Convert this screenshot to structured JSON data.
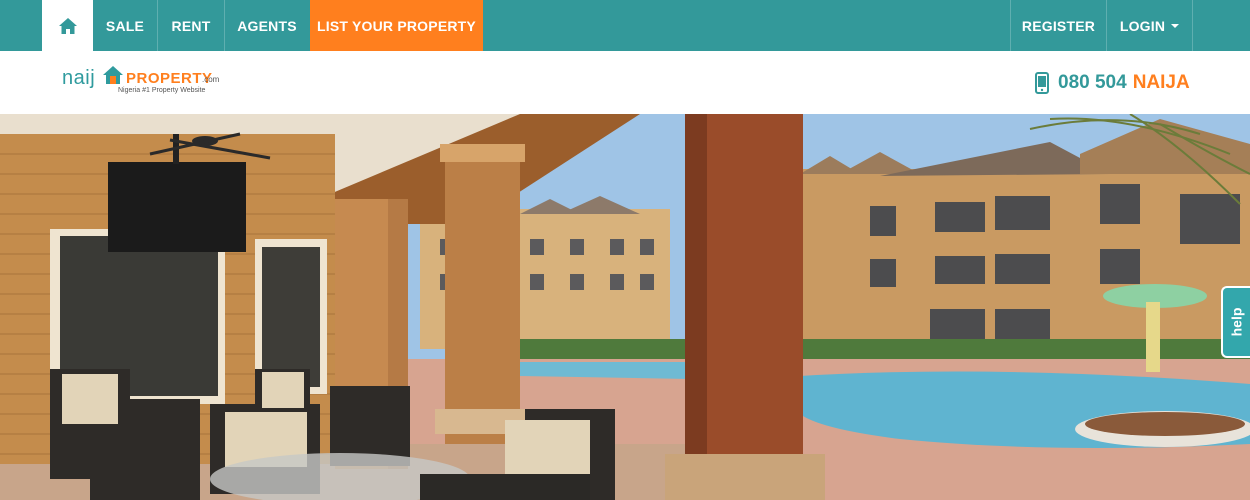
{
  "nav": {
    "home_icon": "home-icon",
    "sale": "SALE",
    "rent": "RENT",
    "agents": "AGENTS",
    "list_property": "LIST YOUR PROPERTY",
    "register": "REGISTER",
    "login": "LOGIN"
  },
  "logo": {
    "naij": "naij",
    "property": "PROPERTY",
    "com": ".com",
    "tagline": "Nigeria #1 Property Website"
  },
  "contact": {
    "phone_icon": "mobile-phone-icon",
    "number": "080 504",
    "word": "NAIJA"
  },
  "help": {
    "label": "help"
  },
  "colors": {
    "primary": "#33999a",
    "accent": "#ff7f1e",
    "help": "#33a7ac"
  }
}
